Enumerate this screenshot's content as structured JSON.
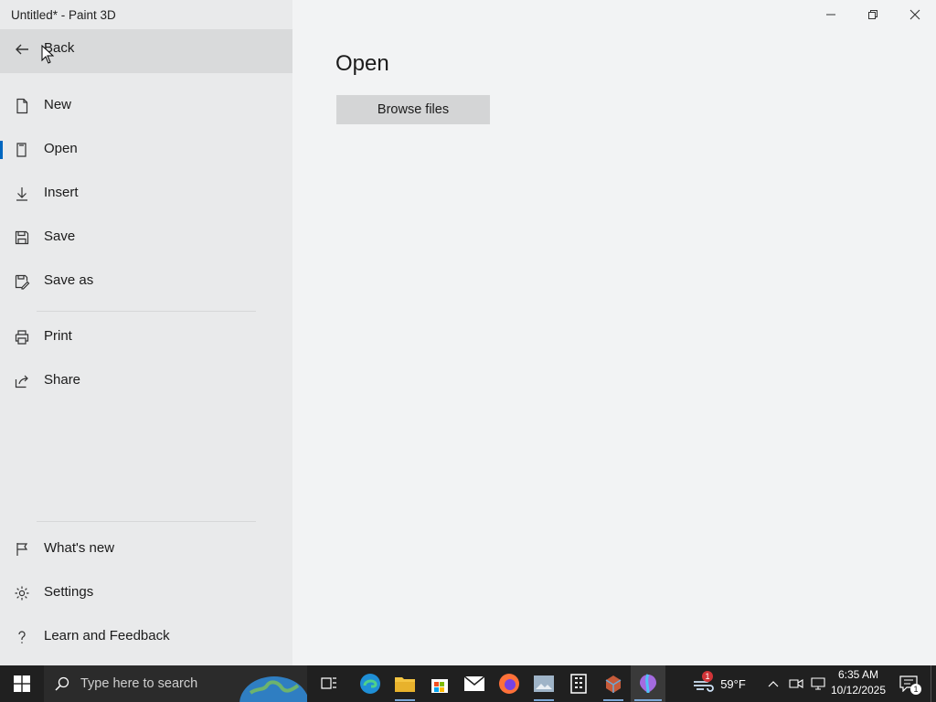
{
  "window": {
    "title": "Untitled* - Paint 3D"
  },
  "sidebar": {
    "back_label": "Back",
    "items": [
      {
        "label": "New",
        "icon": "new-file-icon"
      },
      {
        "label": "Open",
        "icon": "open-folder-icon",
        "selected": true
      },
      {
        "label": "Insert",
        "icon": "insert-arrow-icon"
      },
      {
        "label": "Save",
        "icon": "save-disk-icon"
      },
      {
        "label": "Save as",
        "icon": "save-as-icon"
      },
      {
        "label": "Print",
        "icon": "printer-icon"
      },
      {
        "label": "Share",
        "icon": "share-icon"
      },
      {
        "label": "What's new",
        "icon": "flag-icon"
      },
      {
        "label": "Settings",
        "icon": "gear-icon"
      },
      {
        "label": "Learn and Feedback",
        "icon": "question-icon"
      }
    ]
  },
  "main": {
    "title": "Open",
    "browse_label": "Browse files"
  },
  "taskbar": {
    "search_placeholder": "Type here to search",
    "weather": "59°F",
    "weather_badge": "1",
    "time": "6:35 AM",
    "date": "10/12/2025",
    "notification_count": "1"
  },
  "colors": {
    "accent": "#0067c0",
    "sidebar_bg": "#e9eaeb",
    "taskbar_bg": "#202020"
  }
}
